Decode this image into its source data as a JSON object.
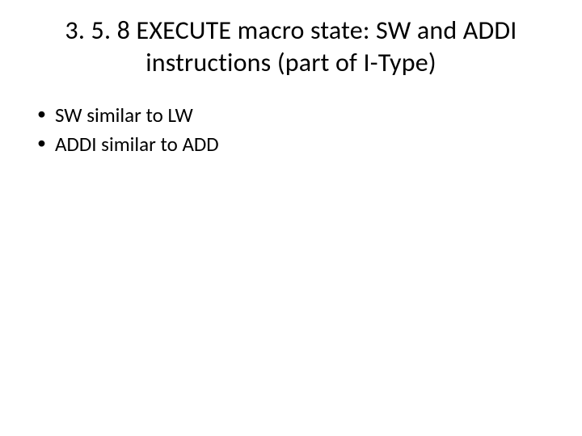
{
  "slide": {
    "title": "3. 5. 8 EXECUTE macro state: SW and ADDI instructions (part of I-Type)",
    "bullets": [
      "SW similar to LW",
      "ADDI similar to ADD"
    ]
  }
}
